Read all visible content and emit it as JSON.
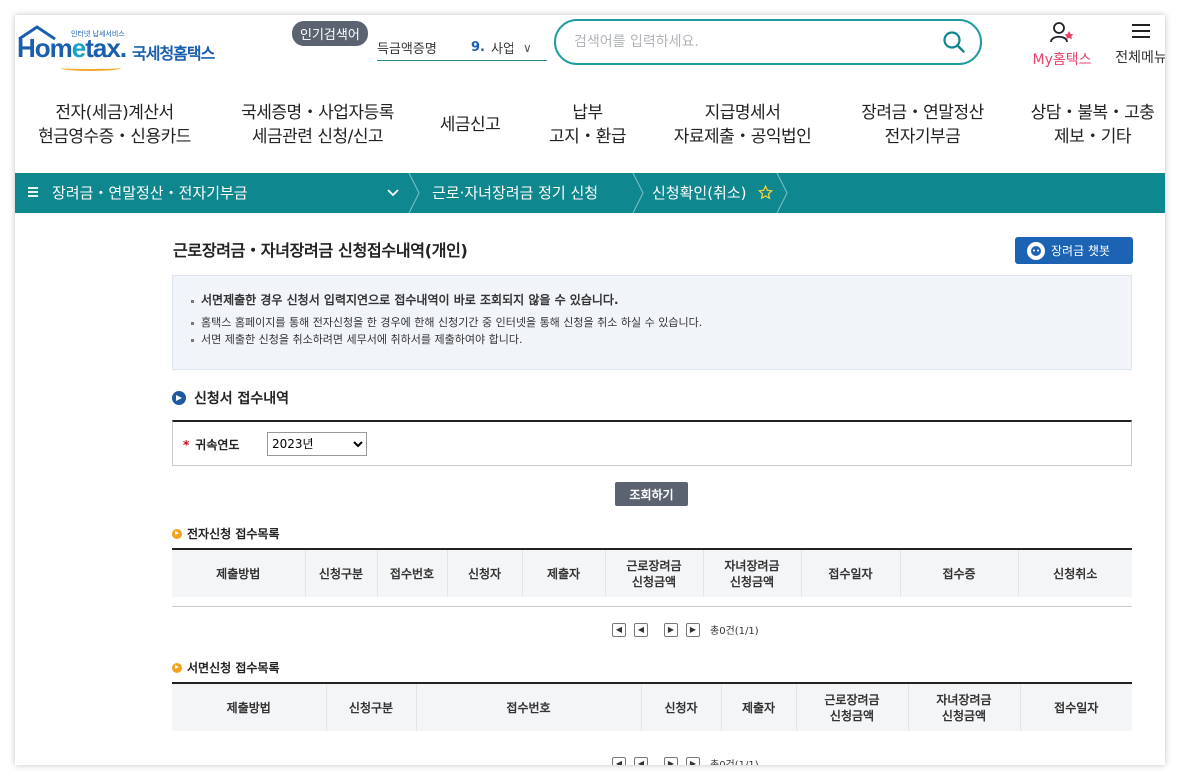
{
  "header": {
    "logo_sub": "인터넷 납세서비스",
    "logo_main_1": "Hom",
    "logo_main_2": "e",
    "logo_main_3": "tax.",
    "logo_kr": "국세청홈택스",
    "popular_badge": "인기검색어",
    "popular_text": "득금액증명",
    "popular_rank": "9.",
    "popular_next": "사업",
    "search_placeholder": "검색어를 입력하세요.",
    "my_hometax": "My홈택스",
    "all_menu": "전체메뉴"
  },
  "gnb": [
    {
      "l1": "전자(세금)계산서",
      "l2": "현금영수증・신용카드"
    },
    {
      "l1": "국세증명・사업자등록",
      "l2": "세금관련 신청/신고"
    },
    {
      "l1": "세금신고",
      "l2": ""
    },
    {
      "l1": "납부",
      "l2": "고지・환급"
    },
    {
      "l1": "지급명세서",
      "l2": "자료제출・공익법인"
    },
    {
      "l1": "장려금・연말정산",
      "l2": "전자기부금"
    },
    {
      "l1": "상담・불복・고충",
      "l2": "제보・기타"
    }
  ],
  "location": {
    "menu": "장려금・연말정산・전자기부금",
    "sub": "근로·자녀장려금 정기 신청",
    "current": "신청확인(취소)"
  },
  "page": {
    "title": "근로장려금・자녀장려금 신청접수내역(개인)",
    "chatbot": "장려금 챗봇",
    "notice": [
      "서면제출한 경우 신청서 입력지연으로 접수내역이 바로 조회되지 않을 수 있습니다.",
      "홈택스 홈페이지를 통해 전자신청을 한 경우에 한해 신청기간 중 인터넷을 통해 신청을 취소 하실 수 있습니다.",
      "서면 제출한 신청을 취소하려면 세무서에 취하서를 제출하여야 합니다."
    ],
    "section_title": "신청서 접수내역",
    "year_label": "귀속연도",
    "year_value": "2023년",
    "search_button": "조회하기",
    "electronic_title": "전자신청 접수목록",
    "paper_title": "서면신청 접수목록",
    "total_text": "총0건(1/1)"
  },
  "electronic_headers": [
    "제출방법",
    "신청구분",
    "접수번호",
    "신청자",
    "제출자",
    "근로장려금\n신청금액",
    "자녀장려금\n신청금액",
    "접수일자",
    "접수증",
    "신청취소"
  ],
  "paper_headers": [
    "제출방법",
    "신청구분",
    "접수번호",
    "신청자",
    "제출자",
    "근로장려금\n신청금액",
    "자녀장려금\n신청금액",
    "접수일자"
  ],
  "colors": {
    "accent": "#0f878f",
    "brand": "#1a5fae",
    "chatbot": "#1d63b4"
  }
}
